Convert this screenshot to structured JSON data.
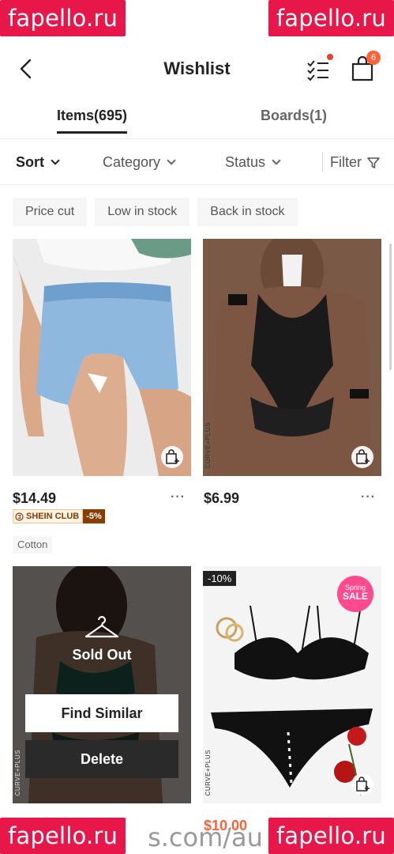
{
  "watermark": {
    "text": "fapello.ru",
    "url_fragment": "s.com/au"
  },
  "header": {
    "title": "Wishlist",
    "cart_count": "6"
  },
  "tabs": [
    {
      "label": "Items(695)"
    },
    {
      "label": "Boards(1)"
    }
  ],
  "filters": {
    "sort": "Sort",
    "category": "Category",
    "status": "Status",
    "filter": "Filter"
  },
  "chips": [
    "Price cut",
    "Low in stock",
    "Back in stock"
  ],
  "products": [
    {
      "price": "$14.49",
      "club_label": "SHEIN CLUB",
      "club_discount": "-5%",
      "tag": "Cotton",
      "image": "denim-shorts-photo"
    },
    {
      "price": "$6.99",
      "brand": "CURVE+PLUS",
      "image": "black-lace-bodysuit-photo"
    },
    {
      "status": "Sold Out",
      "find_similar": "Find Similar",
      "delete": "Delete",
      "brand": "CURVE+PLUS",
      "image": "sequin-lingerie-photo"
    },
    {
      "discount": "-10%",
      "sale_top": "Spring",
      "sale_main": "SALE",
      "brand": "CURVE+PLUS",
      "price": "$10.00",
      "image": "black-lingerie-set-photo"
    }
  ],
  "more_label": "···"
}
